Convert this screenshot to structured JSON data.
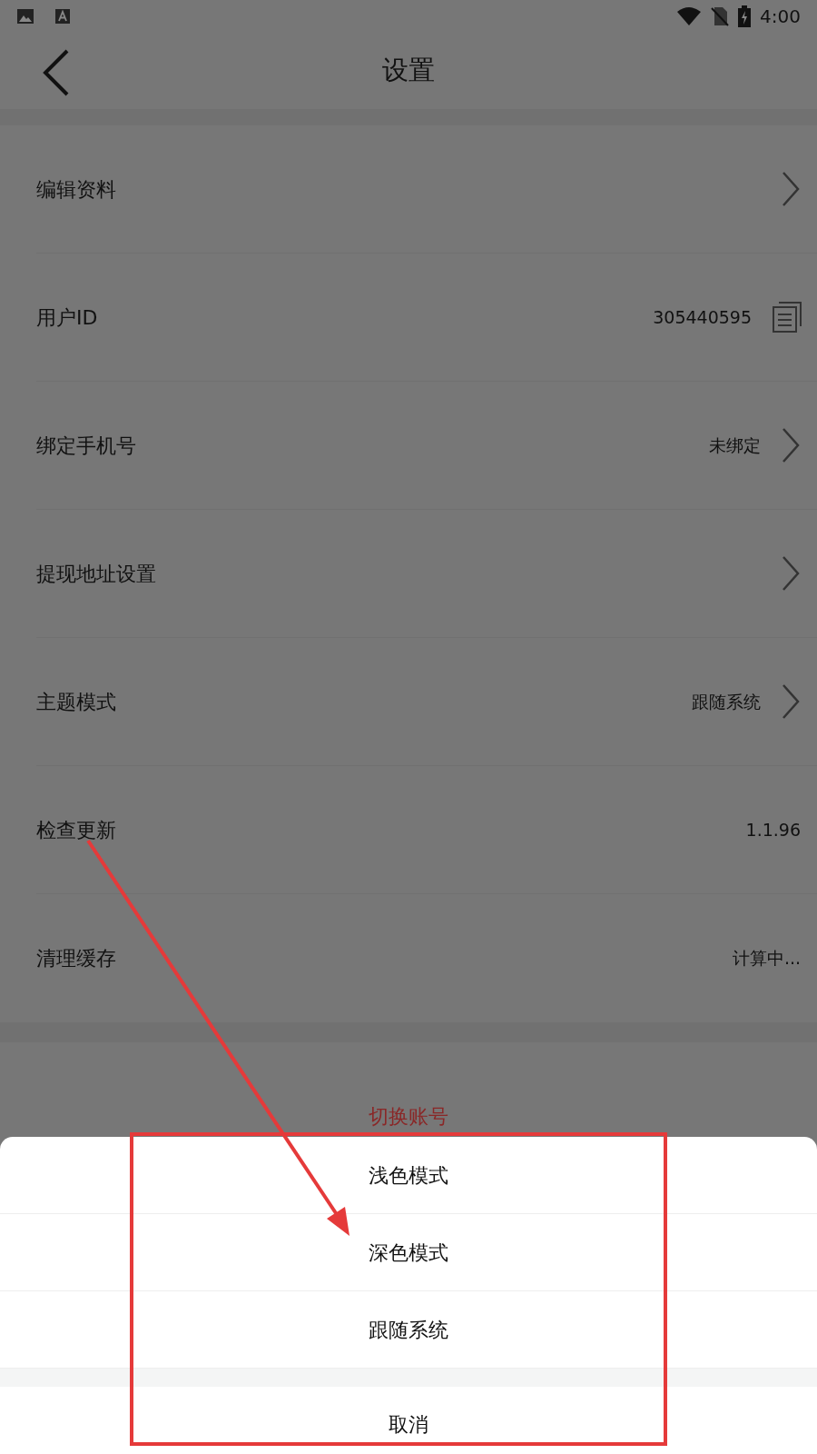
{
  "status_bar": {
    "time": "4:00"
  },
  "header": {
    "title": "设置"
  },
  "settings": [
    {
      "label": "编辑资料",
      "kind": "link"
    },
    {
      "label": "用户ID",
      "value": "305440595",
      "kind": "copy"
    },
    {
      "label": "绑定手机号",
      "value": "未绑定",
      "kind": "link"
    },
    {
      "label": "提现地址设置",
      "kind": "link"
    },
    {
      "label": "主题模式",
      "value": "跟随系统",
      "kind": "link"
    },
    {
      "label": "检查更新",
      "value": "1.1.96",
      "kind": "plain"
    },
    {
      "label": "清理缓存",
      "value": "计算中...",
      "kind": "plain"
    }
  ],
  "switch_account": "切换账号",
  "sheet": {
    "options": [
      "浅色模式",
      "深色模式",
      "跟随系统"
    ],
    "cancel": "取消"
  }
}
